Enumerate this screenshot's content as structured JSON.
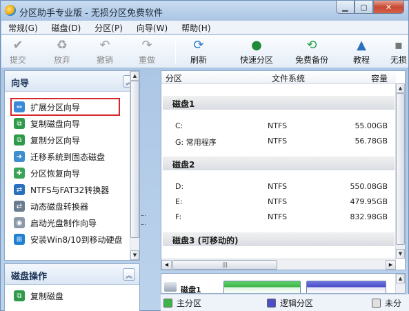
{
  "window": {
    "title": "分区助手专业版 - 无损分区免费软件"
  },
  "menu": [
    "常规(G)",
    "磁盘(D)",
    "分区(P)",
    "向导(W)",
    "帮助(H)"
  ],
  "toolbar": {
    "submit": "提交",
    "discard": "放弃",
    "undo": "撤销",
    "redo": "重做",
    "refresh": "刷新",
    "quick_partition": "快速分区",
    "free_backup": "免费备份",
    "tutorial": "教程",
    "more": "无损"
  },
  "wizard_panel": {
    "title": "向导",
    "items": [
      "扩展分区向导",
      "复制磁盘向导",
      "复制分区向导",
      "迁移系统到固态磁盘",
      "分区恢复向导",
      "NTFS与FAT32转换器",
      "动态磁盘转换器",
      "启动光盘制作向导",
      "安装Win8/10到移动硬盘"
    ]
  },
  "disk_ops_panel": {
    "title": "磁盘操作",
    "items": [
      "复制磁盘"
    ]
  },
  "table": {
    "headers": {
      "partition": "分区",
      "filesystem": "文件系统",
      "capacity": "容量"
    },
    "disks": [
      {
        "name": "磁盘1",
        "partitions": [
          {
            "partition": "C:",
            "filesystem": "NTFS",
            "capacity": "55.00GB"
          },
          {
            "partition": "G: 常用程序",
            "filesystem": "NTFS",
            "capacity": "56.78GB"
          }
        ]
      },
      {
        "name": "磁盘2",
        "partitions": [
          {
            "partition": "D:",
            "filesystem": "NTFS",
            "capacity": "550.08GB"
          },
          {
            "partition": "E:",
            "filesystem": "NTFS",
            "capacity": "479.95GB"
          },
          {
            "partition": "F:",
            "filesystem": "NTFS",
            "capacity": "832.98GB"
          }
        ]
      },
      {
        "name": "磁盘3 (可移动的)",
        "partitions": []
      }
    ]
  },
  "diskmap": {
    "label": "磁盘1"
  },
  "legend": {
    "primary": "主分区",
    "logical": "逻辑分区",
    "unallocated": "未分",
    "primary_color": "#3fb24a",
    "logical_color": "#4a4fc6",
    "unallocated_color": "#e0e0e0"
  }
}
